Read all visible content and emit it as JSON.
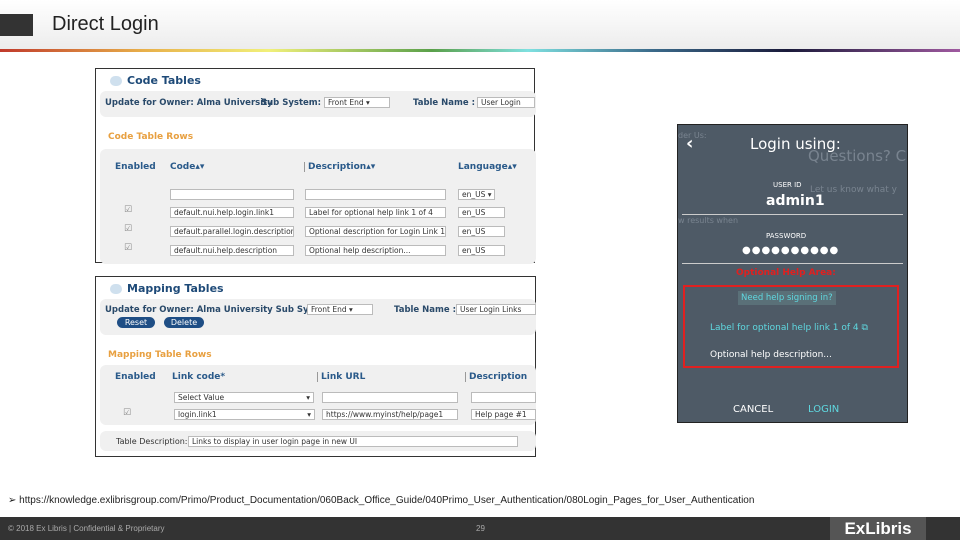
{
  "header": {
    "title": "Direct Login"
  },
  "code_tables": {
    "title": "Code Tables",
    "owner_label": "Update for Owner: Alma University",
    "subsystem_label": "Sub System:",
    "subsystem_value": "Front End",
    "table_name_label": "Table Name :",
    "table_name_value": "User Login",
    "rows_title": "Code Table Rows",
    "columns": [
      "Enabled",
      "Code",
      "Description",
      "Language"
    ],
    "filter_language": "en_US",
    "rows": [
      {
        "enabled": true,
        "code": "default.nui.help.login.link1",
        "description": "Label for optional help link 1 of 4",
        "language": "en_US"
      },
      {
        "enabled": true,
        "code": "default.parallel.login.description1",
        "description": "Optional description for Login Link 1",
        "language": "en_US"
      },
      {
        "enabled": true,
        "code": "default.nui.help.description",
        "description": "Optional help description...",
        "language": "en_US"
      }
    ]
  },
  "mapping_tables": {
    "title": "Mapping Tables",
    "owner_label": "Update for Owner: Alma University Sub System :",
    "subsystem_value": "Front End",
    "table_name_label": "Table Name :",
    "table_name_value": "User Login Links",
    "reset": "Reset",
    "delete": "Delete",
    "rows_title": "Mapping Table Rows",
    "columns": [
      "Enabled",
      "Link code*",
      "Link URL",
      "Description"
    ],
    "filter_link_code": "Select Value",
    "rows": [
      {
        "enabled": true,
        "link_code": "login.link1",
        "url": "https://www.myinst/help/page1",
        "description": "Help page #1"
      }
    ],
    "table_description_label": "Table Description:",
    "table_description_value": "Links to display in user login page in new UI"
  },
  "login": {
    "title": "Login using:",
    "ghost": [
      "der Us:",
      "Questions? Co",
      "Let us know what y",
      "w results when"
    ],
    "userid_label": "USER ID",
    "userid_value": "admin1",
    "password_label": "PASSWORD",
    "password_value": "●●●●●●●●●●",
    "help_area_label": "Optional Help Area:",
    "need_help": "Need help signing in?",
    "help_link": "Label for optional help link 1 of 4",
    "help_description": "Optional help description...",
    "cancel": "CANCEL",
    "login": "LOGIN"
  },
  "reference_link": "https://knowledge.exlibrisgroup.com/Primo/Product_Documentation/060Back_Office_Guide/040Primo_User_Authentication/080Login_Pages_for_User_Authentication",
  "footer": {
    "copyright": "© 2018 Ex Libris | Confidential & Proprietary",
    "page": "29",
    "logo": "ExLibris"
  },
  "colors": {
    "accent": "#1e4a78",
    "orange": "#e8a040",
    "help_red": "#e02020",
    "phone_bg": "#4e5a66",
    "link_cyan": "#5fd8e0"
  }
}
